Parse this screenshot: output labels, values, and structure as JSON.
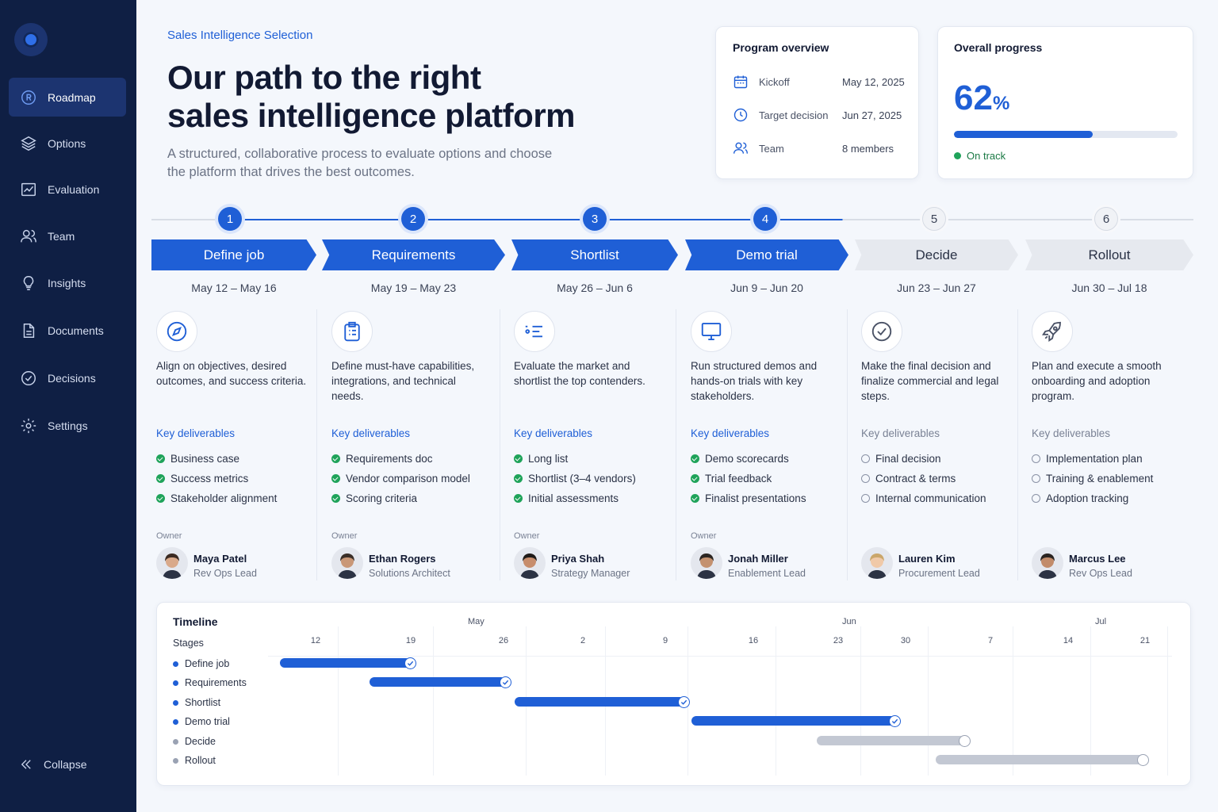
{
  "sidebar": {
    "items": [
      {
        "label": "Roadmap",
        "icon": "roadmap-icon",
        "active": true
      },
      {
        "label": "Options",
        "icon": "layers-icon"
      },
      {
        "label": "Evaluation",
        "icon": "chart-icon"
      },
      {
        "label": "Team",
        "icon": "team-icon"
      },
      {
        "label": "Insights",
        "icon": "lightbulb-icon"
      },
      {
        "label": "Documents",
        "icon": "document-icon"
      },
      {
        "label": "Decisions",
        "icon": "check-circle-icon"
      },
      {
        "label": "Settings",
        "icon": "gear-icon"
      }
    ],
    "collapse_label": "Collapse"
  },
  "header": {
    "eyebrow": "Sales Intelligence Selection",
    "title_line1": "Our path to the right",
    "title_line2": "sales intelligence platform",
    "subtitle": "A structured, collaborative process to evaluate options and choose the platform that drives the best outcomes."
  },
  "overview": {
    "title": "Program overview",
    "rows": [
      {
        "label": "Kickoff",
        "value": "May 12, 2025",
        "icon": "calendar-icon"
      },
      {
        "label": "Target decision",
        "value": "Jun 27, 2025",
        "icon": "clock-icon"
      },
      {
        "label": "Team",
        "value": "8 members",
        "icon": "team-icon"
      }
    ]
  },
  "progress": {
    "title": "Overall progress",
    "value": "62",
    "unit": "%",
    "fraction": 0.62,
    "status": "On track"
  },
  "colors": {
    "accent": "#1f5fd6",
    "done": "#1fa35a",
    "pending": "#c3c8d3",
    "sidebar": "#0f1f44"
  },
  "phases": [
    {
      "num": "1",
      "name": "Define job",
      "dates": "May 12 – May 16",
      "status": "done",
      "icon": "compass-icon",
      "desc": "Align on objectives, desired outcomes, and success criteria.",
      "kd_label": "Key deliverables",
      "deliverables": [
        "Business case",
        "Success metrics",
        "Stakeholder alignment"
      ],
      "owner_label": "Owner",
      "owner_name": "Maya Patel",
      "owner_role": "Rev Ops Lead"
    },
    {
      "num": "2",
      "name": "Requirements",
      "dates": "May 19 – May 23",
      "status": "done",
      "icon": "clipboard-icon",
      "desc": "Define must-have capabilities, integrations, and technical needs.",
      "kd_label": "Key deliverables",
      "deliverables": [
        "Requirements doc",
        "Vendor comparison model",
        "Scoring criteria"
      ],
      "owner_label": "Owner",
      "owner_name": "Ethan Rogers",
      "owner_role": "Solutions Architect"
    },
    {
      "num": "3",
      "name": "Shortlist",
      "dates": "May 26 – Jun 6",
      "status": "done",
      "icon": "list-filter-icon",
      "desc": "Evaluate the market and shortlist the top contenders.",
      "kd_label": "Key deliverables",
      "deliverables": [
        "Long list",
        "Shortlist (3–4 vendors)",
        "Initial assessments"
      ],
      "owner_label": "Owner",
      "owner_name": "Priya Shah",
      "owner_role": "Strategy Manager"
    },
    {
      "num": "4",
      "name": "Demo trial",
      "dates": "Jun 9 – Jun 20",
      "status": "done",
      "icon": "monitor-icon",
      "desc": "Run structured demos and hands-on trials with key stakeholders.",
      "kd_label": "Key deliverables",
      "deliverables": [
        "Demo scorecards",
        "Trial feedback",
        "Finalist presentations"
      ],
      "owner_label": "Owner",
      "owner_name": "Jonah Miller",
      "owner_role": "Enablement Lead"
    },
    {
      "num": "5",
      "name": "Decide",
      "dates": "Jun 23 – Jun 27",
      "status": "todo",
      "icon": "check-circle-icon",
      "desc": "Make the final decision and finalize commercial and legal steps.",
      "kd_label": "Key deliverables",
      "deliverables": [
        "Final decision",
        "Contract & terms",
        "Internal communication"
      ],
      "owner_label": "",
      "owner_name": "Lauren Kim",
      "owner_role": "Procurement Lead"
    },
    {
      "num": "6",
      "name": "Rollout",
      "dates": "Jun 30 – Jul 18",
      "status": "todo",
      "icon": "rocket-icon",
      "desc": "Plan and execute a smooth onboarding and adoption program.",
      "kd_label": "Key deliverables",
      "deliverables": [
        "Implementation plan",
        "Training & enablement",
        "Adoption tracking"
      ],
      "owner_label": "",
      "owner_name": "Marcus Lee",
      "owner_role": "Rev Ops Lead"
    }
  ],
  "timeline": {
    "title": "Timeline",
    "stages_label": "Stages",
    "months": [
      "May",
      "Jun",
      "Jul"
    ],
    "ticks": [
      "12",
      "19",
      "26",
      "2",
      "9",
      "16",
      "23",
      "30",
      "7",
      "14",
      "21"
    ],
    "stages": [
      {
        "name": "Define job",
        "status": "done"
      },
      {
        "name": "Requirements",
        "status": "done"
      },
      {
        "name": "Shortlist",
        "status": "done"
      },
      {
        "name": "Demo trial",
        "status": "done"
      },
      {
        "name": "Decide",
        "status": "pending"
      },
      {
        "name": "Rollout",
        "status": "pending"
      }
    ]
  }
}
